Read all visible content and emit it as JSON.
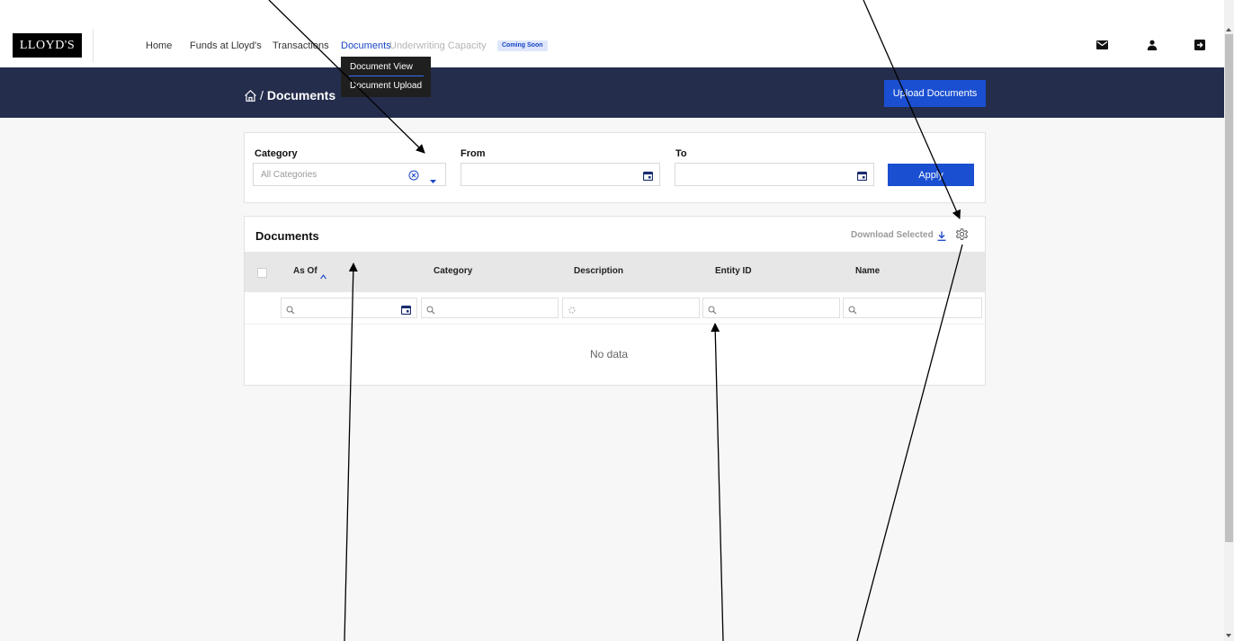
{
  "header": {
    "logo_text": "LLOYD'S",
    "nav": [
      {
        "label": "Home"
      },
      {
        "label": "Funds at Lloyd's"
      },
      {
        "label": "Transactions"
      },
      {
        "label": "Documents",
        "active": true
      },
      {
        "label": "Underwriting Capacity",
        "disabled": true
      }
    ],
    "coming_soon_badge": "Coming Soon",
    "icons": [
      "mail-icon",
      "user-icon",
      "logout-icon"
    ]
  },
  "documents_menu": {
    "items": [
      {
        "label": "Document View",
        "selected": true
      },
      {
        "label": "Document Upload"
      }
    ]
  },
  "banner": {
    "breadcrumb_separator": "/",
    "breadcrumb_current": "Documents",
    "upload_button": "Upload Documents"
  },
  "filters": {
    "category_label": "Category",
    "category_value": "All Categories",
    "from_label": "From",
    "to_label": "To",
    "apply_button": "Apply"
  },
  "documents": {
    "title": "Documents",
    "download_selected": "Download Selected",
    "columns": [
      {
        "label": "As Of",
        "sorted": "asc"
      },
      {
        "label": "Category"
      },
      {
        "label": "Description"
      },
      {
        "label": "Entity ID"
      },
      {
        "label": "Name"
      }
    ],
    "empty_message": "No data"
  },
  "colors": {
    "primary_blue": "#1a4fd1",
    "banner_navy": "#252d4d",
    "active_nav": "#1846c6",
    "annotation_arrow": "#000000"
  }
}
